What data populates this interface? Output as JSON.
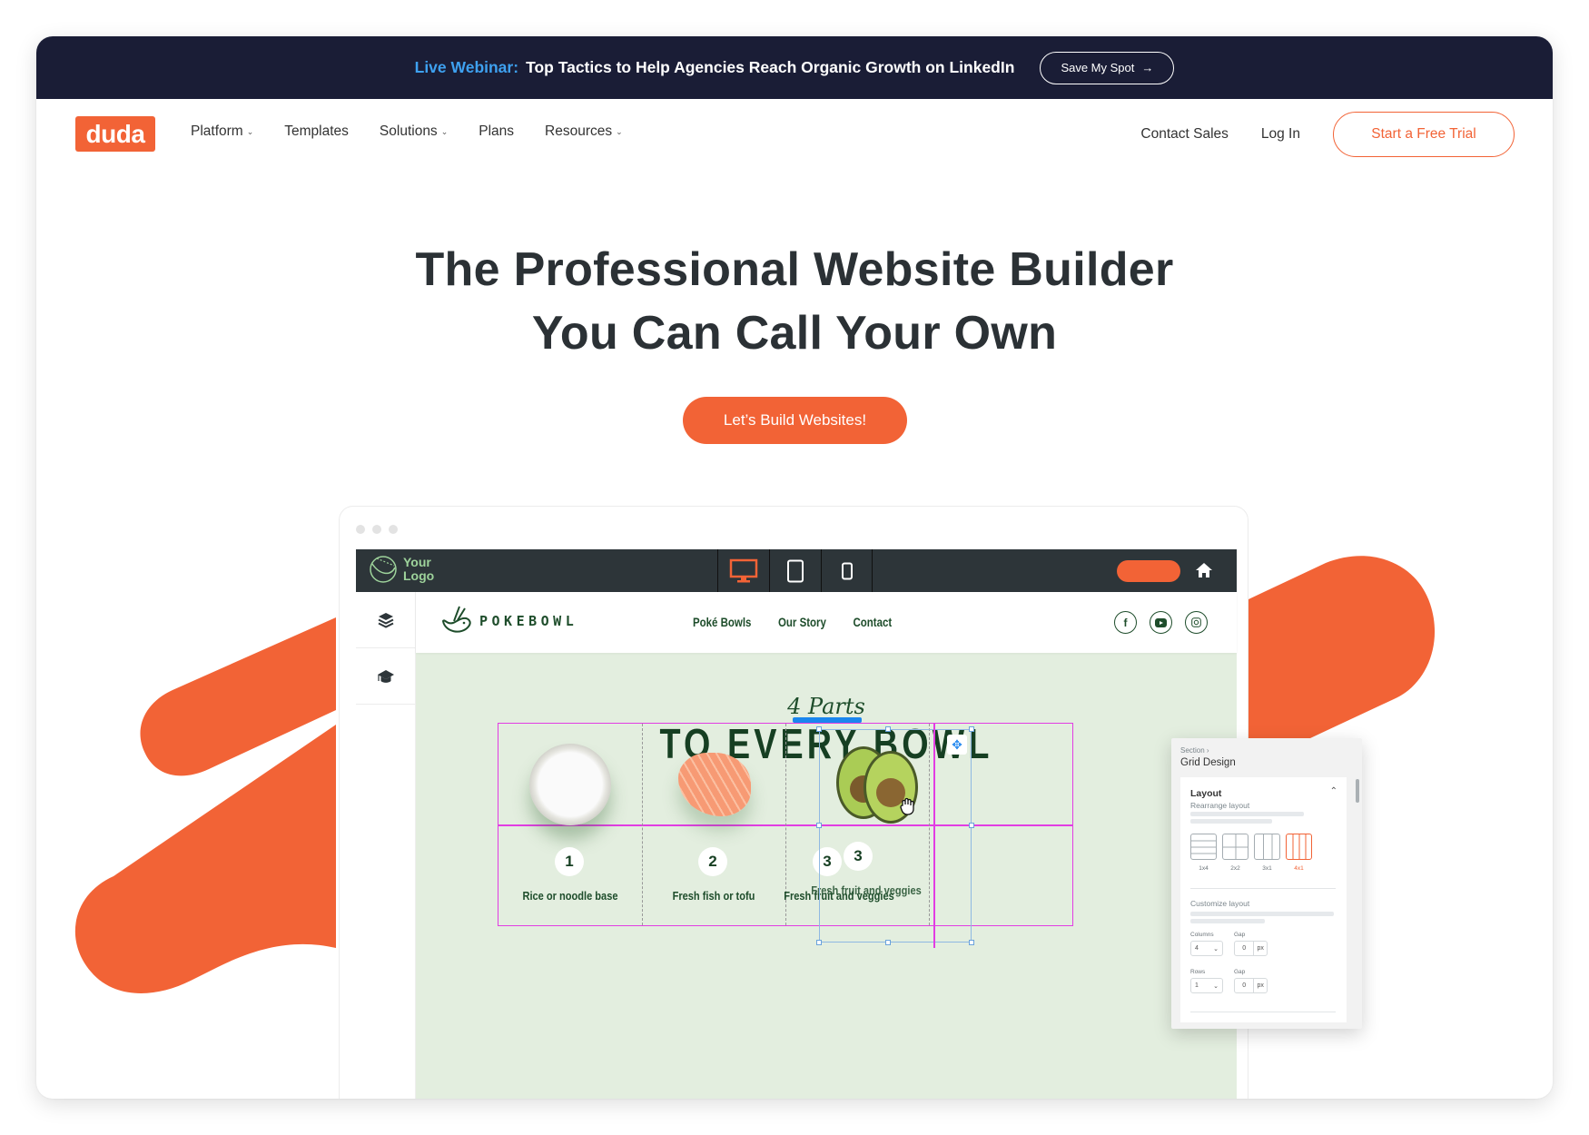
{
  "banner": {
    "highlight": "Live Webinar:",
    "text": "Top Tactics to Help Agencies Reach Organic Growth on LinkedIn",
    "button_label": "Save My Spot",
    "button_icon": "arrow-right-icon"
  },
  "nav": {
    "logo_text": "duda",
    "items": [
      {
        "label": "Platform",
        "has_dropdown": true
      },
      {
        "label": "Templates",
        "has_dropdown": false
      },
      {
        "label": "Solutions",
        "has_dropdown": true
      },
      {
        "label": "Plans",
        "has_dropdown": false
      },
      {
        "label": "Resources",
        "has_dropdown": true
      }
    ],
    "contact_sales": "Contact Sales",
    "log_in": "Log In",
    "trial_button": "Start a Free Trial"
  },
  "hero": {
    "headline_line1": "The Professional Website Builder",
    "headline_line2": "You Can Call Your Own",
    "cta_label": "Let’s Build Websites!"
  },
  "colors": {
    "brand_orange": "#f26336",
    "banner_navy": "#1a1d36",
    "banner_highlight": "#3ea1f0",
    "headline_text": "#2b3135",
    "editor_toolbar": "#2d3539",
    "site_green_bg": "#e3eedf",
    "site_dark_green": "#1e4d2b",
    "grid_guide_magenta": "#e23de3",
    "selection_blue": "#8fb8e2"
  },
  "editor": {
    "logo_line1": "Your",
    "logo_line2": "Logo",
    "devices": [
      {
        "name": "desktop",
        "active": true
      },
      {
        "name": "tablet",
        "active": false
      },
      {
        "name": "mobile",
        "active": false
      }
    ],
    "sidebar_icons": [
      "layers-icon",
      "graduation-cap-icon"
    ],
    "site": {
      "brand": "POKEBOWL",
      "nav": [
        "Poké Bowls",
        "Our Story",
        "Contact"
      ],
      "social": [
        "facebook",
        "youtube",
        "instagram"
      ],
      "subtitle": "4 Parts",
      "title": "TO EVERY BOWL",
      "cells": [
        {
          "num": "1",
          "label": "Rice or noodle base",
          "image": "rice-bowl"
        },
        {
          "num": "2",
          "label": "Fresh fish or tofu",
          "image": "salmon-slices"
        },
        {
          "num": "3",
          "label": "Fresh fruit and veggies",
          "image": "avocado"
        }
      ],
      "ghost_num": "3",
      "ghost_label": "Fresh fruit and veggies"
    }
  },
  "panel": {
    "breadcrumb": "Section",
    "title": "Grid Design",
    "section_layout": "Layout",
    "rearrange_label": "Rearrange layout",
    "layout_options": [
      {
        "label": "1x4",
        "active": false
      },
      {
        "label": "2x2",
        "active": false
      },
      {
        "label": "3x1",
        "active": false
      },
      {
        "label": "4x1",
        "active": true
      }
    ],
    "customize_label": "Customize layout",
    "columns_label": "Columns",
    "columns_value": "4",
    "rows_label": "Rows",
    "rows_value": "1",
    "gap_label": "Gap",
    "col_gap_value": "0",
    "row_gap_value": "0",
    "unit": "px"
  }
}
